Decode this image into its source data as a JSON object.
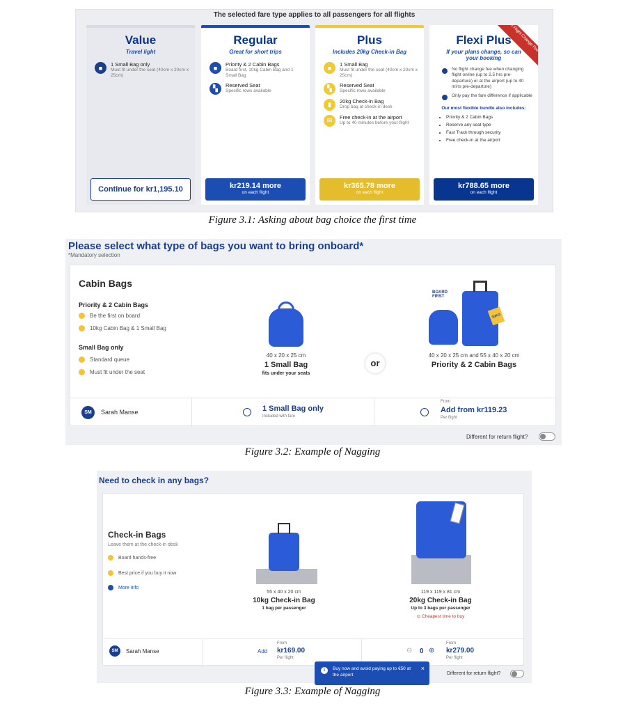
{
  "fig1": {
    "top_note": "The selected fare type applies to all passengers for all flights",
    "fares": [
      {
        "name": "Value",
        "tagline": "Travel light",
        "features": [
          {
            "t": "1 Small Bag only",
            "d": "Must fit under the seat (40cm x 20cm x 25cm)"
          }
        ],
        "cta": "Continue for kr1,195.10",
        "cta_sub": ""
      },
      {
        "name": "Regular",
        "tagline": "Great for short trips",
        "features": [
          {
            "t": "Priority & 2 Cabin Bags",
            "d": "Board first, 10kg Cabin Bag and 1 Small Bag"
          },
          {
            "t": "Reserved Seat",
            "d": "Specific rows available"
          }
        ],
        "cta": "kr219.14 more",
        "cta_sub": "on each flight"
      },
      {
        "name": "Plus",
        "tagline": "Includes 20kg Check-in Bag",
        "features": [
          {
            "t": "1 Small Bag",
            "d": "Must fit under the seat (40cm x 20cm x 25cm)"
          },
          {
            "t": "Reserved Seat",
            "d": "Specific rows available"
          },
          {
            "t": "20kg Check-in Bag",
            "d": "Drop bag at check-in desk"
          },
          {
            "t": "Free check-in at the airport",
            "d": "Up to 40 minutes before your flight"
          }
        ],
        "cta": "kr365.78 more",
        "cta_sub": "on each flight"
      },
      {
        "name": "Flexi Plus",
        "tagline": "If your plans change, so can your booking",
        "checks": [
          "No flight change fee when changing flight online (up to 2.5 hrs pre-departure) or at the airport (up to 40 mins pre-departure)",
          "Only pay the fare difference if applicable"
        ],
        "bundle_title": "Our most flexible bundle also includes:",
        "bundle": [
          "Priority & 2 Cabin Bags",
          "Reserve any seat type",
          "Fast Track through security",
          "Free check-in at the airport"
        ],
        "ribbon": "No Flight Change Fee",
        "cta": "kr788.65 more",
        "cta_sub": "on each flight"
      }
    ],
    "caption": "Figure 3.1: Asking about bag choice the first time"
  },
  "fig2": {
    "title": "Please select what type of bags you want to bring onboard*",
    "mandatory": "*Mandatory selection",
    "heading": "Cabin Bags",
    "group1": "Priority & 2 Cabin Bags",
    "group1_items": [
      "Be the first on board",
      "10kg Cabin Bag & 1 Small Bag"
    ],
    "group2": "Small Bag only",
    "group2_items": [
      "Standard queue",
      "Must fit under the seat"
    ],
    "opt1_dims": "40 x 20 x 25 cm",
    "opt1_name": "1 Small Bag",
    "opt1_note": "fits under your seats",
    "or": "or",
    "opt2_dims": "40 x 20 x 25 cm and 55 x 40 x 20 cm",
    "opt2_name": "Priority & 2 Cabin Bags",
    "board_first": "BOARD FIRST",
    "tag10": "10KG",
    "initials": "SM",
    "passenger": "Sarah Manse",
    "choice1": "1 Small Bag only",
    "choice1_sub": "Included with fare",
    "choice2_from": "From",
    "choice2": "Add from kr119.23",
    "choice2_sub": "Per flight",
    "return": "Different for return flight?",
    "caption": "Figure 3.2: Example of Nagging"
  },
  "fig3": {
    "title": "Need to check in any bags?",
    "heading": "Check-in Bags",
    "subheading": "Leave them at the check-in desk",
    "items": [
      "Board hands-free",
      "Best price if you buy it now"
    ],
    "more": "More info",
    "bag1_dims": "55 x 40 x 20 cm",
    "bag1_name": "10kg Check-in Bag",
    "bag1_note": "1 bag per passenger",
    "bag2_dims": "119 x 119 x 81 cm",
    "bag2_name": "20kg Check-in Bag",
    "bag2_note": "Up to 3 bags per passenger",
    "bag2_alert": "Cheapest time to buy",
    "initials": "SM",
    "passenger": "Sarah Manse",
    "add": "Add",
    "p1_from": "From",
    "p1": "kr169.00",
    "p1_sub": "Per flight",
    "qty": "0",
    "p2_from": "From",
    "p2": "kr279.00",
    "p2_sub": "Per flight",
    "toast": "Buy now and avoid paying up to €50 at the airport",
    "toast_close": "×",
    "return": "Different for return flight?",
    "caption": "Figure 3.3: Example of Nagging"
  }
}
